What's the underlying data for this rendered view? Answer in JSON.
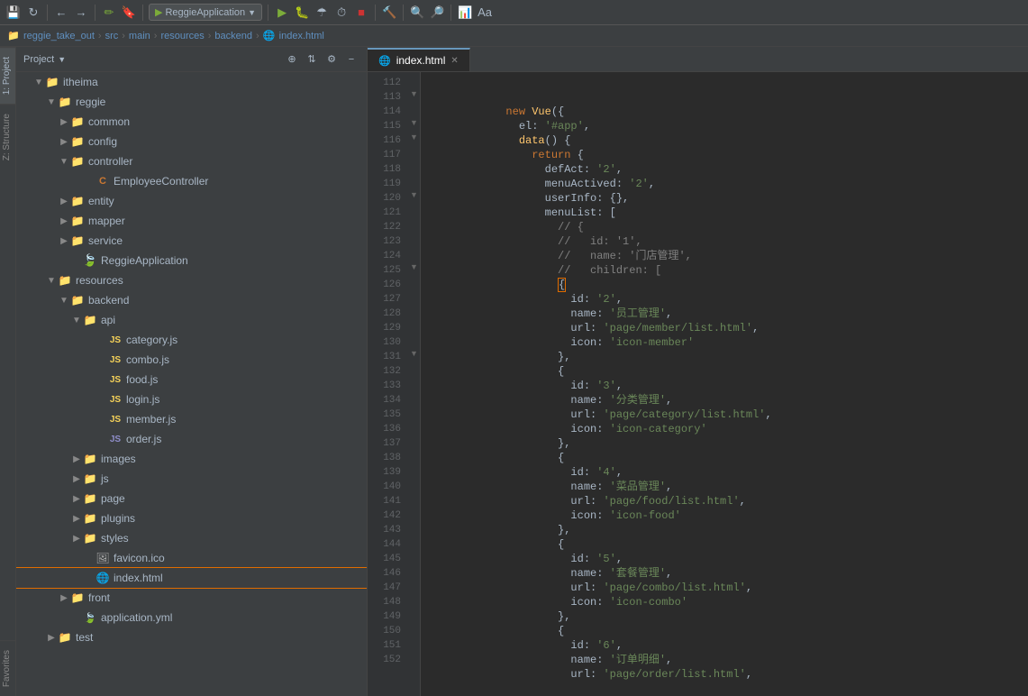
{
  "toolbar": {
    "app_name": "ReggieApplication",
    "icons": [
      "save",
      "sync",
      "back",
      "forward",
      "annotate",
      "bookmark",
      "run",
      "debug",
      "coverage",
      "profile",
      "stop",
      "build",
      "search-results",
      "search",
      "profile2",
      "analyze"
    ]
  },
  "breadcrumb": {
    "items": [
      "reggie_take_out",
      "src",
      "main",
      "resources",
      "backend",
      "index.html"
    ],
    "separators": [
      ">",
      ">",
      ">",
      ">",
      ">"
    ]
  },
  "sidebar": {
    "header": {
      "title": "Project",
      "actions": [
        "+",
        "⊕",
        "≡",
        "-"
      ]
    },
    "tree": [
      {
        "id": "itheima",
        "label": "itheima",
        "indent": 1,
        "type": "folder",
        "expanded": true,
        "arrow": "▼"
      },
      {
        "id": "reggie",
        "label": "reggie",
        "indent": 2,
        "type": "folder",
        "expanded": true,
        "arrow": "▼"
      },
      {
        "id": "common",
        "label": "common",
        "indent": 3,
        "type": "folder",
        "expanded": false,
        "arrow": "▶"
      },
      {
        "id": "config",
        "label": "config",
        "indent": 3,
        "type": "folder",
        "expanded": false,
        "arrow": "▶"
      },
      {
        "id": "controller",
        "label": "controller",
        "indent": 3,
        "type": "folder",
        "expanded": true,
        "arrow": "▼"
      },
      {
        "id": "EmployeeController",
        "label": "EmployeeController",
        "indent": 4,
        "type": "java",
        "arrow": ""
      },
      {
        "id": "entity",
        "label": "entity",
        "indent": 3,
        "type": "folder",
        "expanded": false,
        "arrow": "▶"
      },
      {
        "id": "mapper",
        "label": "mapper",
        "indent": 3,
        "type": "folder",
        "expanded": false,
        "arrow": "▶"
      },
      {
        "id": "service",
        "label": "service",
        "indent": 3,
        "type": "folder",
        "expanded": false,
        "arrow": "▶"
      },
      {
        "id": "ReggieApplication",
        "label": "ReggieApplication",
        "indent": 3,
        "type": "spring",
        "arrow": ""
      },
      {
        "id": "resources",
        "label": "resources",
        "indent": 2,
        "type": "folder",
        "expanded": true,
        "arrow": "▼"
      },
      {
        "id": "backend",
        "label": "backend",
        "indent": 3,
        "type": "folder",
        "expanded": true,
        "arrow": "▼"
      },
      {
        "id": "api",
        "label": "api",
        "indent": 4,
        "type": "folder",
        "expanded": true,
        "arrow": "▼"
      },
      {
        "id": "category.js",
        "label": "category.js",
        "indent": 5,
        "type": "js",
        "arrow": ""
      },
      {
        "id": "combo.js",
        "label": "combo.js",
        "indent": 5,
        "type": "js",
        "arrow": ""
      },
      {
        "id": "food.js",
        "label": "food.js",
        "indent": 5,
        "type": "js",
        "arrow": ""
      },
      {
        "id": "login.js",
        "label": "login.js",
        "indent": 5,
        "type": "js",
        "arrow": ""
      },
      {
        "id": "member.js",
        "label": "member.js",
        "indent": 5,
        "type": "js",
        "arrow": ""
      },
      {
        "id": "order.js",
        "label": "order.js",
        "indent": 5,
        "type": "js",
        "arrow": ""
      },
      {
        "id": "images",
        "label": "images",
        "indent": 4,
        "type": "folder",
        "expanded": false,
        "arrow": "▶"
      },
      {
        "id": "js",
        "label": "js",
        "indent": 4,
        "type": "folder",
        "expanded": false,
        "arrow": "▶"
      },
      {
        "id": "page",
        "label": "page",
        "indent": 4,
        "type": "folder",
        "expanded": false,
        "arrow": "▶"
      },
      {
        "id": "plugins",
        "label": "plugins",
        "indent": 4,
        "type": "folder",
        "expanded": false,
        "arrow": "▶"
      },
      {
        "id": "styles",
        "label": "styles",
        "indent": 4,
        "type": "folder",
        "expanded": false,
        "arrow": "▶"
      },
      {
        "id": "favicon.ico",
        "label": "favicon.ico",
        "indent": 4,
        "type": "img",
        "arrow": ""
      },
      {
        "id": "index.html",
        "label": "index.html",
        "indent": 4,
        "type": "html",
        "arrow": "",
        "selected": true
      },
      {
        "id": "front",
        "label": "front",
        "indent": 3,
        "type": "folder",
        "expanded": false,
        "arrow": "▶"
      },
      {
        "id": "application.yml",
        "label": "application.yml",
        "indent": 3,
        "type": "yml",
        "arrow": ""
      },
      {
        "id": "test",
        "label": "test",
        "indent": 2,
        "type": "folder",
        "expanded": false,
        "arrow": "▶"
      }
    ]
  },
  "editor": {
    "tab": "index.html",
    "lines": [
      {
        "n": 112,
        "code": ""
      },
      {
        "n": 113,
        "code": "  new Vue({"
      },
      {
        "n": 114,
        "code": "    el: '#app',"
      },
      {
        "n": 115,
        "code": "    data() {"
      },
      {
        "n": 116,
        "code": "      return {"
      },
      {
        "n": 117,
        "code": "        defAct: '2',"
      },
      {
        "n": 118,
        "code": "        menuActived: '2',"
      },
      {
        "n": 119,
        "code": "        userInfo: {},"
      },
      {
        "n": 120,
        "code": "        menuList: ["
      },
      {
        "n": 121,
        "code": "          // {"
      },
      {
        "n": 122,
        "code": "          //   id: '1',"
      },
      {
        "n": 123,
        "code": "          //   name: '门店管理',"
      },
      {
        "n": 124,
        "code": "          //   children: ["
      },
      {
        "n": 125,
        "code": "          {"
      },
      {
        "n": 126,
        "code": "            id: '2',"
      },
      {
        "n": 127,
        "code": "            name: '员工管理',"
      },
      {
        "n": 128,
        "code": "            url: 'page/member/list.html',"
      },
      {
        "n": 129,
        "code": "            icon: 'icon-member'"
      },
      {
        "n": 130,
        "code": "          },"
      },
      {
        "n": 131,
        "code": "          {"
      },
      {
        "n": 132,
        "code": "            id: '3',"
      },
      {
        "n": 133,
        "code": "            name: '分类管理',"
      },
      {
        "n": 134,
        "code": "            url: 'page/category/list.html',"
      },
      {
        "n": 135,
        "code": "            icon: 'icon-category'"
      },
      {
        "n": 136,
        "code": "          },"
      },
      {
        "n": 137,
        "code": "          {"
      },
      {
        "n": 138,
        "code": "            id: '4',"
      },
      {
        "n": 139,
        "code": "            name: '菜品管理',"
      },
      {
        "n": 140,
        "code": "            url: 'page/food/list.html',"
      },
      {
        "n": 141,
        "code": "            icon: 'icon-food'"
      },
      {
        "n": 142,
        "code": "          },"
      },
      {
        "n": 143,
        "code": "          {"
      },
      {
        "n": 144,
        "code": "            id: '5',"
      },
      {
        "n": 145,
        "code": "            name: '套餐管理',"
      },
      {
        "n": 146,
        "code": "            url: 'page/combo/list.html',"
      },
      {
        "n": 147,
        "code": "            icon: 'icon-combo'"
      },
      {
        "n": 148,
        "code": "          },"
      },
      {
        "n": 149,
        "code": "          {"
      },
      {
        "n": 150,
        "code": "            id: '6',"
      },
      {
        "n": 151,
        "code": "            name: '订单明细',"
      },
      {
        "n": 152,
        "code": "            url: 'page/order/list.html',"
      }
    ]
  },
  "side_labels": [
    {
      "id": "project",
      "label": "1: Project",
      "active": true
    },
    {
      "id": "structure",
      "label": "Z: Structure",
      "active": false
    },
    {
      "id": "favorites",
      "label": "Favorites",
      "active": false
    }
  ],
  "colors": {
    "accent_orange": "#e06c00",
    "selected_blue": "#2d5a8e",
    "tab_active_border": "#6897bb"
  }
}
